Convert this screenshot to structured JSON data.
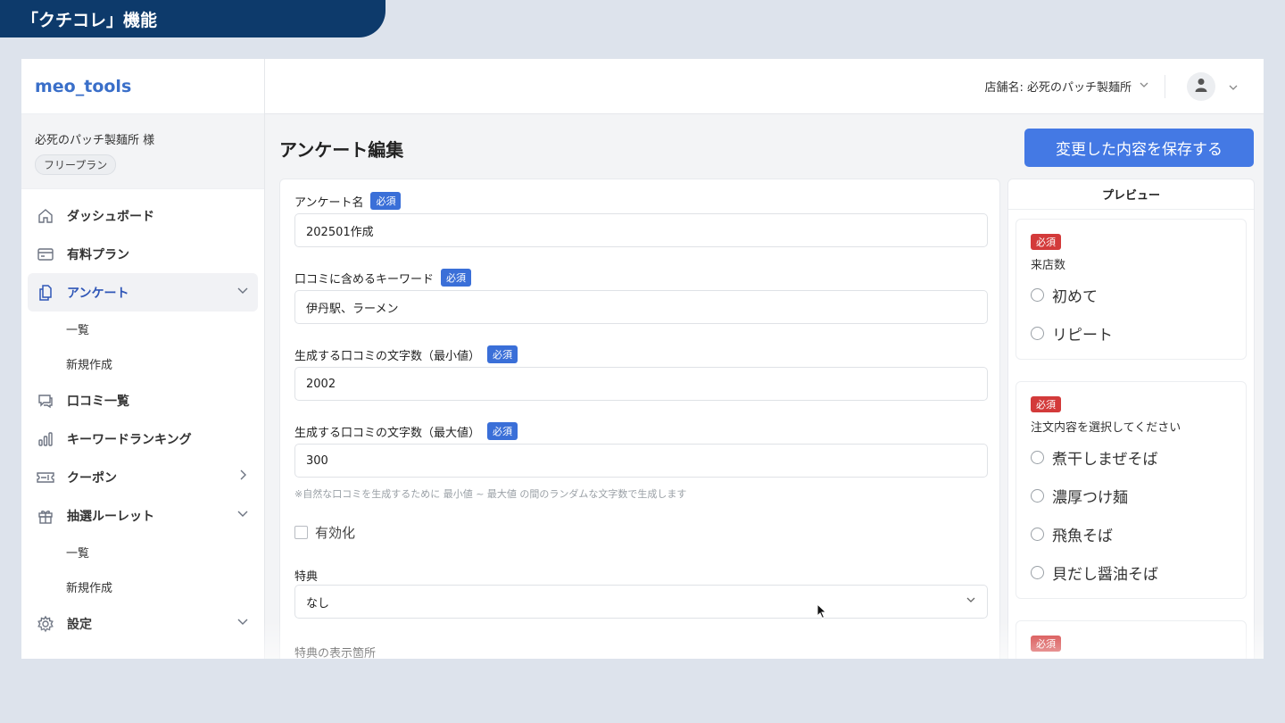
{
  "banner": {
    "title": "「クチコレ」機能"
  },
  "app": {
    "brand": "meo_tools"
  },
  "account": {
    "name": "必死のパッチ製麺所 様",
    "plan": "フリープラン"
  },
  "sidebar": {
    "items": [
      {
        "label": "ダッシュボード",
        "icon": "home-icon"
      },
      {
        "label": "有料プラン",
        "icon": "card-icon"
      },
      {
        "label": "アンケート",
        "icon": "document-icon",
        "active": true,
        "expanded": true
      },
      {
        "label": "一覧",
        "sub": true
      },
      {
        "label": "新規作成",
        "sub": true
      },
      {
        "label": "口コミ一覧",
        "icon": "chat-icon"
      },
      {
        "label": "キーワードランキング",
        "icon": "bar-chart-icon"
      },
      {
        "label": "クーポン",
        "icon": "ticket-icon",
        "chevron": "right"
      },
      {
        "label": "抽選ルーレット",
        "icon": "gift-icon",
        "expanded": true
      },
      {
        "label": "一覧",
        "sub": true
      },
      {
        "label": "新規作成",
        "sub": true
      },
      {
        "label": "設定",
        "icon": "gear-icon",
        "expanded": false
      }
    ]
  },
  "topbar": {
    "store_label": "店舗名: 必死のパッチ製麺所"
  },
  "page": {
    "title": "アンケート編集",
    "save_label": "変更した内容を保存する"
  },
  "form": {
    "required_badge": "必須",
    "survey_name": {
      "label": "アンケート名",
      "value": "202501作成"
    },
    "keywords": {
      "label": "口コミに含めるキーワード",
      "value": "伊丹駅、ラーメン"
    },
    "min_chars": {
      "label": "生成する口コミの文字数（最小値）",
      "value": "2002"
    },
    "max_chars": {
      "label": "生成する口コミの文字数（最大値）",
      "value": "300"
    },
    "hint": "※自然な口コミを生成するために 最小値 ~ 最大値 の間のランダムな文字数で生成します",
    "enable": {
      "label": "有効化",
      "checked": false
    },
    "benefit": {
      "label": "特典",
      "value": "なし"
    },
    "benefit_location": {
      "label": "特典の表示箇所"
    }
  },
  "preview": {
    "title": "プレビュー",
    "required_badge": "必須",
    "questions": [
      {
        "label": "来店数",
        "options": [
          "初めて",
          "リピート"
        ]
      },
      {
        "label": "注文内容を選択してください",
        "options": [
          "煮干しまぜそば",
          "濃厚つけ麺",
          "飛魚そば",
          "貝だし醤油そば"
        ]
      }
    ]
  }
}
